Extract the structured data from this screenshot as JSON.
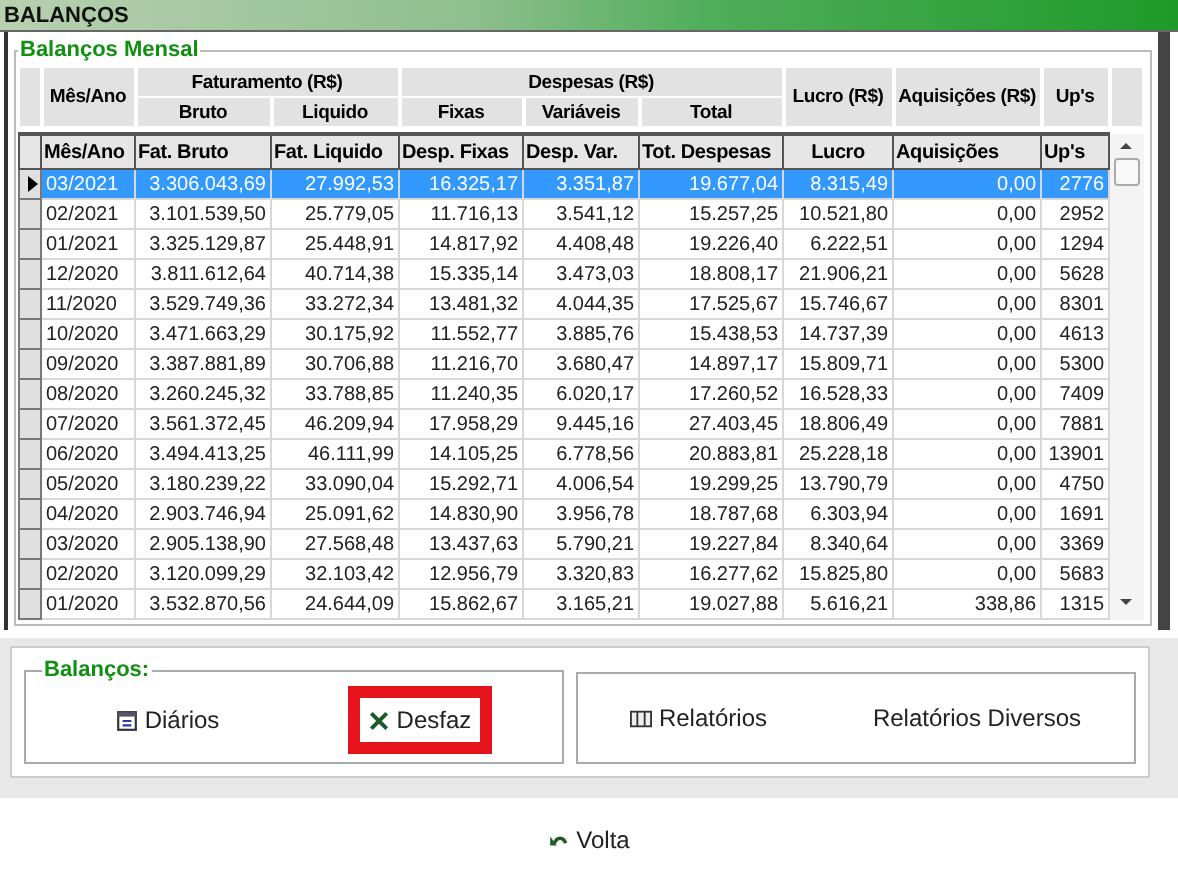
{
  "window": {
    "title": "BALANÇOS"
  },
  "grid": {
    "title": "Balanços Mensal",
    "header_groups": [
      {
        "label": "Mês/Ano"
      },
      {
        "label": "Faturamento (R$)",
        "children": [
          "Bruto",
          "Liquido"
        ]
      },
      {
        "label": "Despesas (R$)",
        "children": [
          "Fixas",
          "Variáveis",
          "Total"
        ]
      },
      {
        "label": "Lucro (R$)"
      },
      {
        "label": "Aquisições (R$)"
      },
      {
        "label": "Up's"
      }
    ],
    "columns": [
      "Mês/Ano",
      "Fat. Bruto",
      "Fat. Liquido",
      "Desp. Fixas",
      "Desp. Var.",
      "Tot. Despesas",
      "Lucro",
      "Aquisições",
      "Up's"
    ],
    "rows": [
      {
        "selected": true,
        "cells": [
          "03/2021",
          "3.306.043,69",
          "27.992,53",
          "16.325,17",
          "3.351,87",
          "19.677,04",
          "8.315,49",
          "0,00",
          "2776"
        ]
      },
      {
        "selected": false,
        "cells": [
          "02/2021",
          "3.101.539,50",
          "25.779,05",
          "11.716,13",
          "3.541,12",
          "15.257,25",
          "10.521,80",
          "0,00",
          "2952"
        ]
      },
      {
        "selected": false,
        "cells": [
          "01/2021",
          "3.325.129,87",
          "25.448,91",
          "14.817,92",
          "4.408,48",
          "19.226,40",
          "6.222,51",
          "0,00",
          "1294"
        ]
      },
      {
        "selected": false,
        "cells": [
          "12/2020",
          "3.811.612,64",
          "40.714,38",
          "15.335,14",
          "3.473,03",
          "18.808,17",
          "21.906,21",
          "0,00",
          "5628"
        ]
      },
      {
        "selected": false,
        "cells": [
          "11/2020",
          "3.529.749,36",
          "33.272,34",
          "13.481,32",
          "4.044,35",
          "17.525,67",
          "15.746,67",
          "0,00",
          "8301"
        ]
      },
      {
        "selected": false,
        "cells": [
          "10/2020",
          "3.471.663,29",
          "30.175,92",
          "11.552,77",
          "3.885,76",
          "15.438,53",
          "14.737,39",
          "0,00",
          "4613"
        ]
      },
      {
        "selected": false,
        "cells": [
          "09/2020",
          "3.387.881,89",
          "30.706,88",
          "11.216,70",
          "3.680,47",
          "14.897,17",
          "15.809,71",
          "0,00",
          "5300"
        ]
      },
      {
        "selected": false,
        "cells": [
          "08/2020",
          "3.260.245,32",
          "33.788,85",
          "11.240,35",
          "6.020,17",
          "17.260,52",
          "16.528,33",
          "0,00",
          "7409"
        ]
      },
      {
        "selected": false,
        "cells": [
          "07/2020",
          "3.561.372,45",
          "46.209,94",
          "17.958,29",
          "9.445,16",
          "27.403,45",
          "18.806,49",
          "0,00",
          "7881"
        ]
      },
      {
        "selected": false,
        "cells": [
          "06/2020",
          "3.494.413,25",
          "46.111,99",
          "14.105,25",
          "6.778,56",
          "20.883,81",
          "25.228,18",
          "0,00",
          "13901"
        ]
      },
      {
        "selected": false,
        "cells": [
          "05/2020",
          "3.180.239,22",
          "33.090,04",
          "15.292,71",
          "4.006,54",
          "19.299,25",
          "13.790,79",
          "0,00",
          "4750"
        ]
      },
      {
        "selected": false,
        "cells": [
          "04/2020",
          "2.903.746,94",
          "25.091,62",
          "14.830,90",
          "3.956,78",
          "18.787,68",
          "6.303,94",
          "0,00",
          "1691"
        ]
      },
      {
        "selected": false,
        "cells": [
          "03/2020",
          "2.905.138,90",
          "27.568,48",
          "13.437,63",
          "5.790,21",
          "19.227,84",
          "8.340,64",
          "0,00",
          "3369"
        ]
      },
      {
        "selected": false,
        "cells": [
          "02/2020",
          "3.120.099,29",
          "32.103,42",
          "12.956,79",
          "3.320,83",
          "16.277,62",
          "15.825,80",
          "0,00",
          "5683"
        ]
      },
      {
        "selected": false,
        "cells": [
          "01/2020",
          "3.532.870,56",
          "24.644,09",
          "15.862,67",
          "3.165,21",
          "19.027,88",
          "5.616,21",
          "338,86",
          "1315"
        ]
      }
    ]
  },
  "actions": {
    "group_title": "Balanços:",
    "left": [
      {
        "label": "Diários",
        "kind": "calendar",
        "highlighted": false
      },
      {
        "label": "Desfaz",
        "kind": "cross",
        "highlighted": true
      }
    ],
    "right": [
      {
        "label": "Relatórios",
        "kind": "book",
        "highlighted": false
      },
      {
        "label": "Relatórios Diversos",
        "kind": "text",
        "highlighted": false
      }
    ]
  },
  "back_button": {
    "label": "Volta"
  }
}
